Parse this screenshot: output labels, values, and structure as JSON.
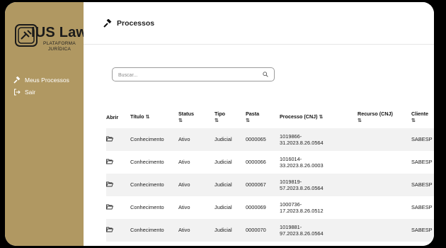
{
  "sidebar": {
    "logo_title": "IUS Law",
    "logo_subtitle": "PLATAFORMA JURÍDICA",
    "items": [
      {
        "label": "Meus Processos",
        "icon": "gavel-icon"
      },
      {
        "label": "Sair",
        "icon": "logout-icon"
      }
    ]
  },
  "header": {
    "title": "Processos",
    "icon": "gavel-icon"
  },
  "search": {
    "placeholder": "Buscar...",
    "value": ""
  },
  "table": {
    "sort_glyph": "⇅",
    "columns": [
      {
        "label": "Abrir",
        "sortable": false
      },
      {
        "label": "Título",
        "sortable": true
      },
      {
        "label": "Status",
        "sortable": true
      },
      {
        "label": "Tipo",
        "sortable": true
      },
      {
        "label": "Pasta",
        "sortable": true
      },
      {
        "label": "Processo (CNJ)",
        "sortable": true
      },
      {
        "label": "Recurso (CNJ)",
        "sortable": true
      },
      {
        "label": "Cliente",
        "sortable": true
      }
    ],
    "rows": [
      {
        "titulo": "Conhecimento",
        "status": "Ativo",
        "tipo": "Judicial",
        "pasta": "0000065",
        "processo_1": "1019866-",
        "processo_2": "31.2023.8.26.0564",
        "recurso": "",
        "cliente": "SABESP"
      },
      {
        "titulo": "Conhecimento",
        "status": "Ativo",
        "tipo": "Judicial",
        "pasta": "0000066",
        "processo_1": "1016014-",
        "processo_2": "33.2023.8.26.0003",
        "recurso": "",
        "cliente": "SABESP"
      },
      {
        "titulo": "Conhecimento",
        "status": "Ativo",
        "tipo": "Judicial",
        "pasta": "0000067",
        "processo_1": "1019819-",
        "processo_2": "57.2023.8.26.0564",
        "recurso": "",
        "cliente": "SABESP"
      },
      {
        "titulo": "Conhecimento",
        "status": "Ativo",
        "tipo": "Judicial",
        "pasta": "0000069",
        "processo_1": "1000736-",
        "processo_2": "17.2023.8.26.0512",
        "recurso": "",
        "cliente": "SABESP"
      },
      {
        "titulo": "Conhecimento",
        "status": "Ativo",
        "tipo": "Judicial",
        "pasta": "0000070",
        "processo_1": "1019881-",
        "processo_2": "97.2023.8.26.0564",
        "recurso": "",
        "cliente": "SABESP"
      }
    ]
  },
  "colors": {
    "sidebar": "#b09862",
    "row_stripe": "#f2f2f2",
    "frame_bg": "#000000"
  }
}
